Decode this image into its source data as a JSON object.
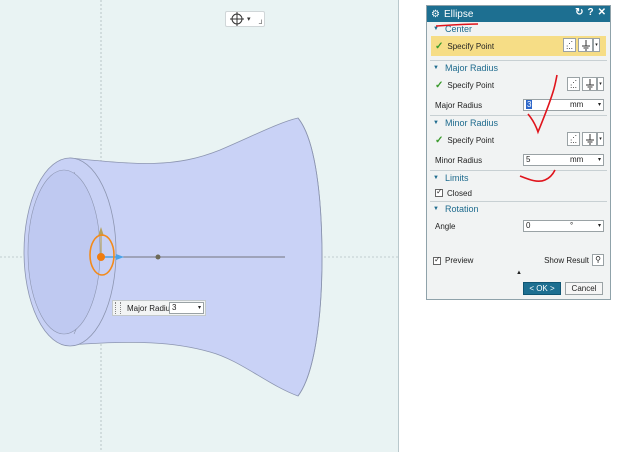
{
  "snap_toolbar": {
    "icon": "snap-point-icon",
    "arrow": "▾",
    "tail": "┘"
  },
  "floating_input": {
    "label": "Major Radius",
    "value": "3",
    "arrow": "▾"
  },
  "dialog": {
    "title": "Ellipse",
    "icons": {
      "settings": "⚙",
      "reset": "↻",
      "help": "?",
      "close": "✕"
    },
    "sections": {
      "center": {
        "title": "Center",
        "specify_point": "Specify Point"
      },
      "major": {
        "title": "Major Radius",
        "specify_point": "Specify Point",
        "field_label": "Major Radius",
        "value": "3",
        "unit": "mm"
      },
      "minor": {
        "title": "Minor Radius",
        "specify_point": "Specify Point",
        "field_label": "Minor Radius",
        "value": "5",
        "unit": "mm"
      },
      "limits": {
        "title": "Limits",
        "closed_label": "Closed",
        "closed_checked": true
      },
      "rotation": {
        "title": "Rotation",
        "angle_label": "Angle",
        "angle_value": "0",
        "angle_unit": "°"
      }
    },
    "preview_label": "Preview",
    "preview_checked": true,
    "show_result_label": "Show Result",
    "ok_label": "< OK >",
    "cancel_label": "Cancel",
    "more_arrow": "▲",
    "dropdown_arrow": "▾"
  },
  "colors": {
    "viewport_bg": "#e9f3f3",
    "model_fill": "#c9d2f6",
    "title_bar": "#1d6f91",
    "highlight": "#f6dd86",
    "annotation_red": "#e0141c",
    "orange_ring": "#f38a1a"
  }
}
